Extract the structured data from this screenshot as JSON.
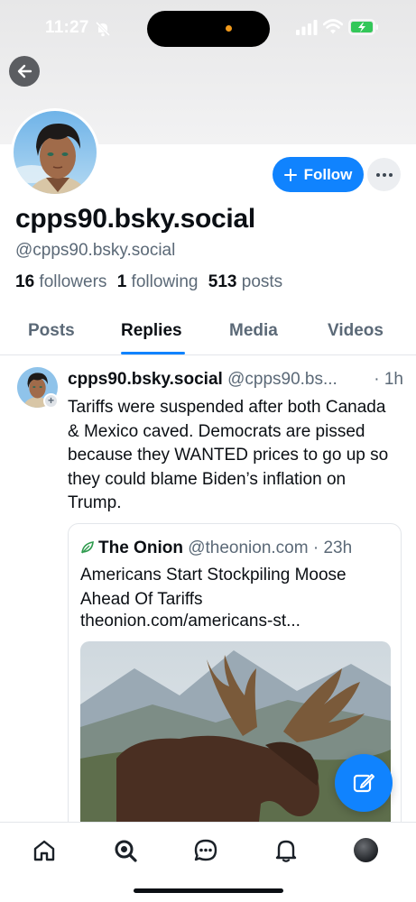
{
  "status_bar": {
    "time": "11:27",
    "icons": [
      "bell-off-icon",
      "cellular-signal-icon",
      "wifi-icon",
      "battery-charging-icon"
    ]
  },
  "header": {
    "back_icon": "arrow-left-icon"
  },
  "profile": {
    "display_name": "cpps90.bsky.social",
    "handle": "@cpps90.bsky.social",
    "follow_label": "Follow",
    "more_icon": "ellipsis-icon",
    "stats": {
      "followers_count": "16",
      "followers_label": "followers",
      "following_count": "1",
      "following_label": "following",
      "posts_count": "513",
      "posts_label": "posts"
    }
  },
  "tabs": [
    {
      "label": "Posts",
      "active": false
    },
    {
      "label": "Replies",
      "active": true
    },
    {
      "label": "Media",
      "active": false
    },
    {
      "label": "Videos",
      "active": false
    }
  ],
  "post": {
    "author": "cpps90.bsky.social",
    "handle": "@cpps90.bs...",
    "time": "· 1h",
    "text": "Tariffs were suspended after both Canada & Mexico caved. Democrats are pissed because they WANTED prices to go up so they could blame Biden’s inflation on Trump.",
    "quote": {
      "author": "The Onion",
      "handle": "@theonion.com",
      "time": "· 23h",
      "title": "Americans Start Stockpiling Moose Ahead Of Tariffs",
      "link": "theonion.com/americans-st..."
    }
  },
  "fab": {
    "icon": "compose-icon"
  },
  "bottom_nav": [
    {
      "icon": "home-icon"
    },
    {
      "icon": "search-icon"
    },
    {
      "icon": "chat-icon"
    },
    {
      "icon": "notifications-bell-icon"
    },
    {
      "icon": "profile-avatar"
    }
  ],
  "colors": {
    "accent": "#1083fe",
    "muted_text": "#5b6977",
    "text": "#0b0f14",
    "divider": "#e3e6ea"
  }
}
